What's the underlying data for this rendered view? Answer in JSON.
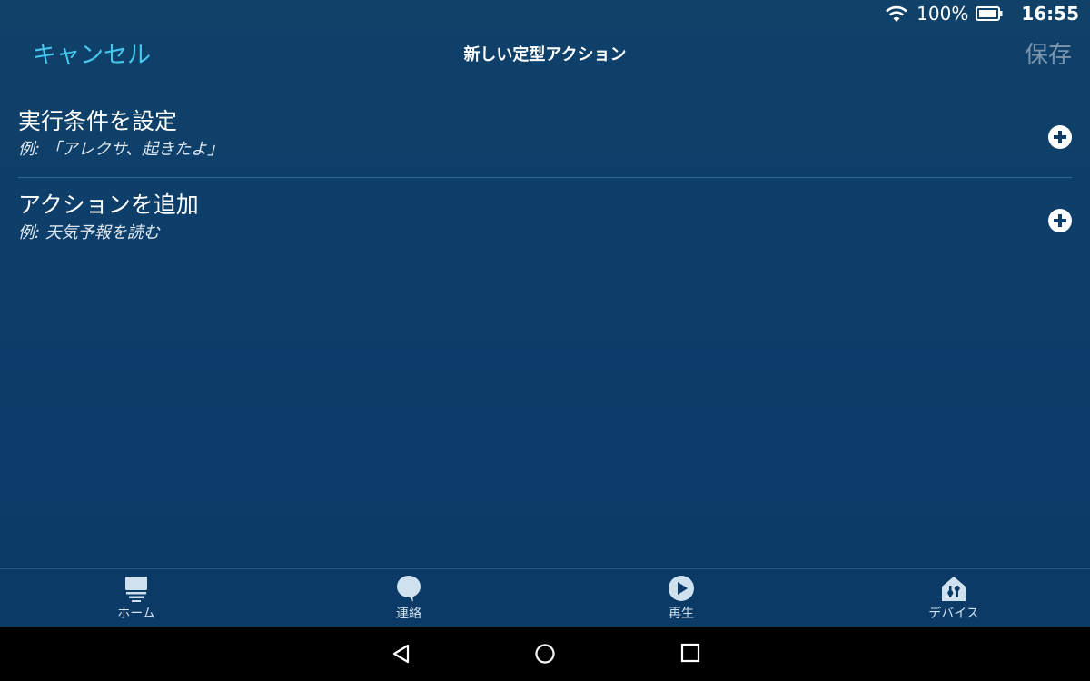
{
  "status": {
    "battery": "100%",
    "time": "16:55"
  },
  "header": {
    "cancel_label": "キャンセル",
    "title": "新しい定型アクション",
    "save_label": "保存"
  },
  "rows": [
    {
      "title": "実行条件を設定",
      "hint": "例: 「アレクサ、起きたよ」"
    },
    {
      "title": "アクションを追加",
      "hint": "例: 天気予報を読む"
    }
  ],
  "tabs": [
    {
      "label": "ホーム",
      "icon": "home-icon"
    },
    {
      "label": "連絡",
      "icon": "chat-bubble-icon"
    },
    {
      "label": "再生",
      "icon": "play-icon"
    },
    {
      "label": "デバイス",
      "icon": "devices-house-icon"
    }
  ],
  "colors": {
    "accent": "#47c7ee",
    "background": "#0d3e6a",
    "save_disabled": "#7a95ad"
  }
}
